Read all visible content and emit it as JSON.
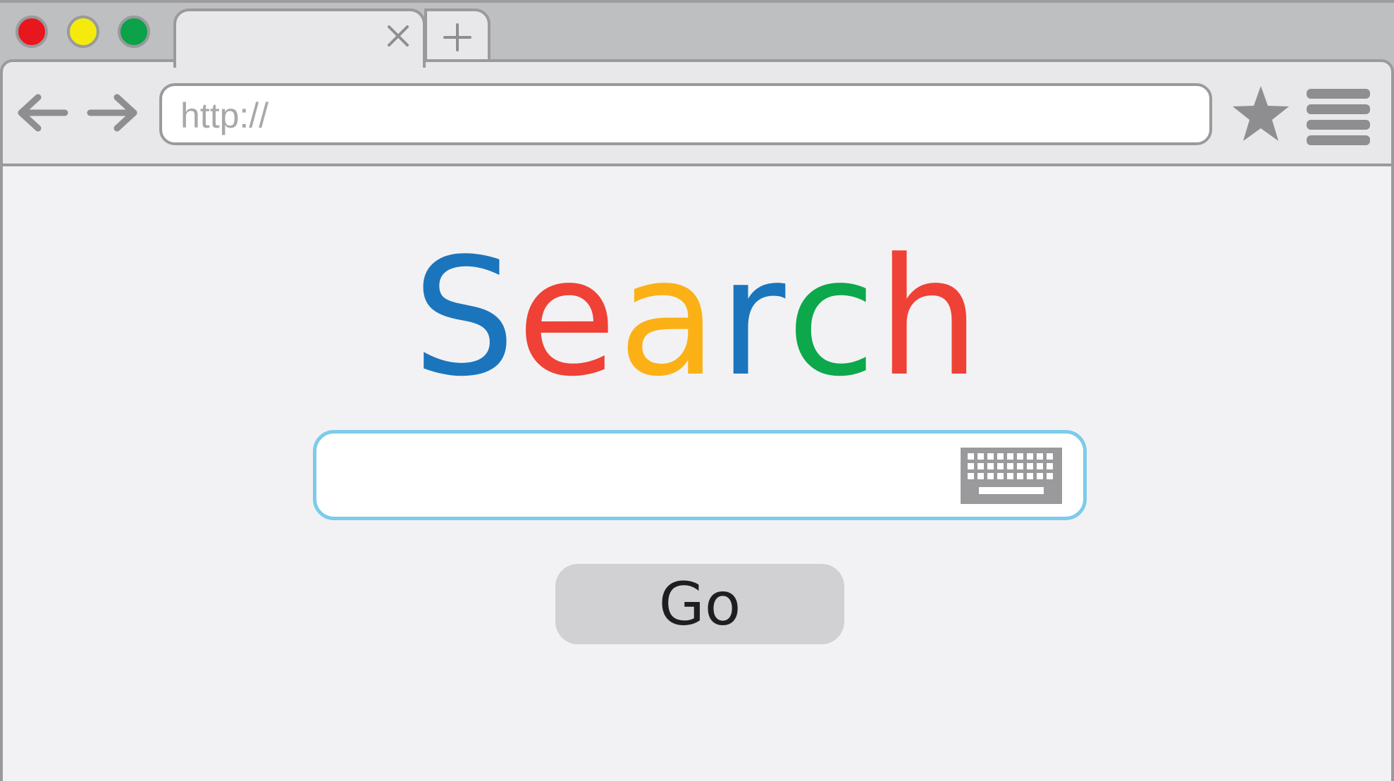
{
  "window": {
    "traffic_lights": [
      {
        "name": "close",
        "color": "#e8161d"
      },
      {
        "name": "minimize",
        "color": "#f4eb0d"
      },
      {
        "name": "maximize",
        "color": "#0ba24a"
      }
    ]
  },
  "tabs": {
    "active_title": "",
    "close_icon": "close-icon",
    "new_tab_icon": "plus-icon"
  },
  "toolbar": {
    "back_icon": "arrow-left-icon",
    "forward_icon": "arrow-right-icon",
    "url_text": "http://",
    "bookmark_icon": "star-icon",
    "menu_icon": "hamburger-menu-icon"
  },
  "main": {
    "logo_letters": [
      {
        "char": "S",
        "color": "#1b75bc"
      },
      {
        "char": "e",
        "color": "#ef4136"
      },
      {
        "char": "a",
        "color": "#fbb116"
      },
      {
        "char": "r",
        "color": "#1b75bc"
      },
      {
        "char": "c",
        "color": "#0ca84b"
      },
      {
        "char": "h",
        "color": "#ef4136"
      }
    ],
    "search": {
      "value": "",
      "placeholder": "",
      "border_color": "#7ccbec",
      "keyboard_icon": "keyboard-icon"
    },
    "go_label": "Go"
  },
  "colors": {
    "chrome": "#bebfc1",
    "toolbar": "#e8e8ea",
    "content_bg": "#f2f2f4",
    "icon_gray": "#8e8e90"
  }
}
